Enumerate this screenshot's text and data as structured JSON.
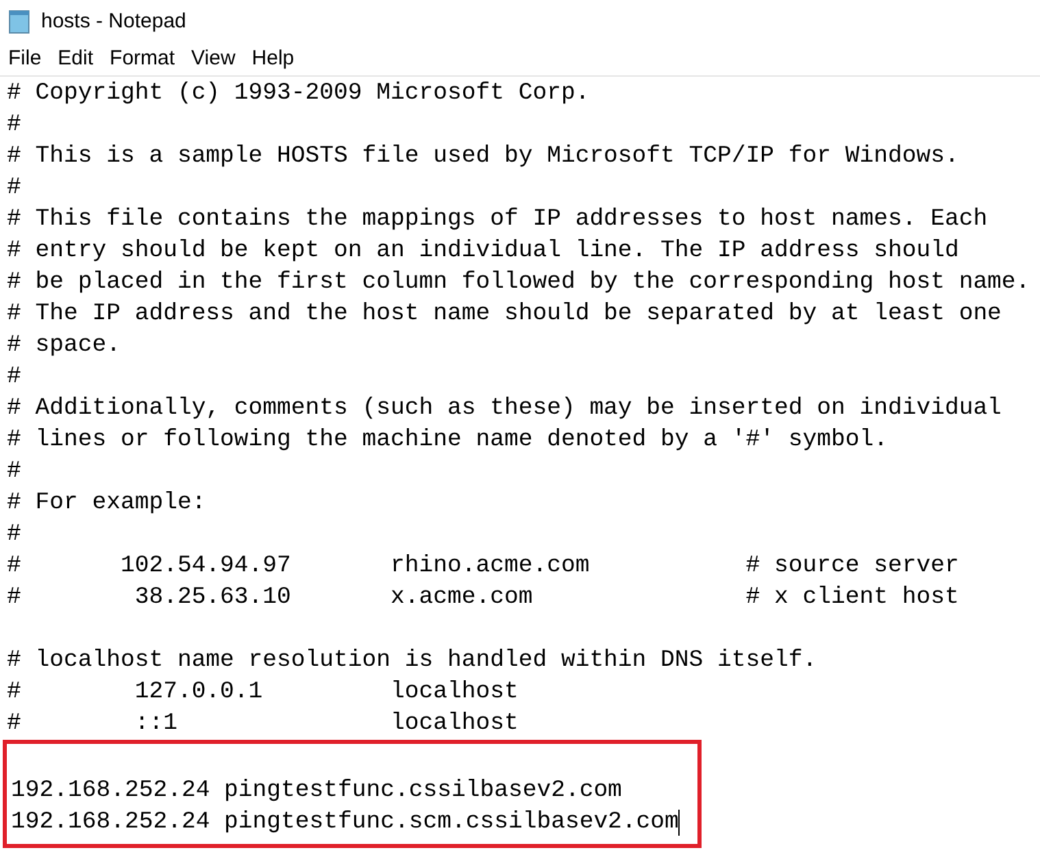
{
  "window": {
    "title": "hosts - Notepad"
  },
  "menu": [
    "File",
    "Edit",
    "Format",
    "View",
    "Help"
  ],
  "editor": {
    "lines": [
      {
        "kind": "text",
        "text": "# Copyright (c) 1993-2009 Microsoft Corp."
      },
      {
        "kind": "text",
        "text": "#"
      },
      {
        "kind": "text",
        "text": "# This is a sample HOSTS file used by Microsoft TCP/IP for Windows."
      },
      {
        "kind": "text",
        "text": "#"
      },
      {
        "kind": "text",
        "text": "# This file contains the mappings of IP addresses to host names. Each"
      },
      {
        "kind": "text",
        "text": "# entry should be kept on an individual line. The IP address should"
      },
      {
        "kind": "text",
        "text": "# be placed in the first column followed by the corresponding host name."
      },
      {
        "kind": "text",
        "text": "# The IP address and the host name should be separated by at least one"
      },
      {
        "kind": "text",
        "text": "# space."
      },
      {
        "kind": "text",
        "text": "#"
      },
      {
        "kind": "text",
        "text": "# Additionally, comments (such as these) may be inserted on individual"
      },
      {
        "kind": "text",
        "text": "# lines or following the machine name denoted by a '#' symbol."
      },
      {
        "kind": "text",
        "text": "#"
      },
      {
        "kind": "text",
        "text": "# For example:"
      },
      {
        "kind": "text",
        "text": "#"
      },
      {
        "kind": "text",
        "text": "#       102.54.94.97       rhino.acme.com           # source server"
      },
      {
        "kind": "text",
        "text": "#        38.25.63.10       x.acme.com               # x client host"
      },
      {
        "kind": "blank"
      },
      {
        "kind": "text",
        "text": "# localhost name resolution is handled within DNS itself."
      },
      {
        "kind": "text",
        "text": "#        127.0.0.1         localhost"
      },
      {
        "kind": "text",
        "text": "#        ::1               localhost"
      }
    ],
    "highlight": {
      "lines": [
        {
          "kind": "blank"
        },
        {
          "kind": "text",
          "text": "192.168.252.24 pingtestfunc.cssilbasev2.com",
          "caret": false
        },
        {
          "kind": "text",
          "text": "192.168.252.24 pingtestfunc.scm.cssilbasev2.com",
          "caret": true
        }
      ]
    }
  }
}
